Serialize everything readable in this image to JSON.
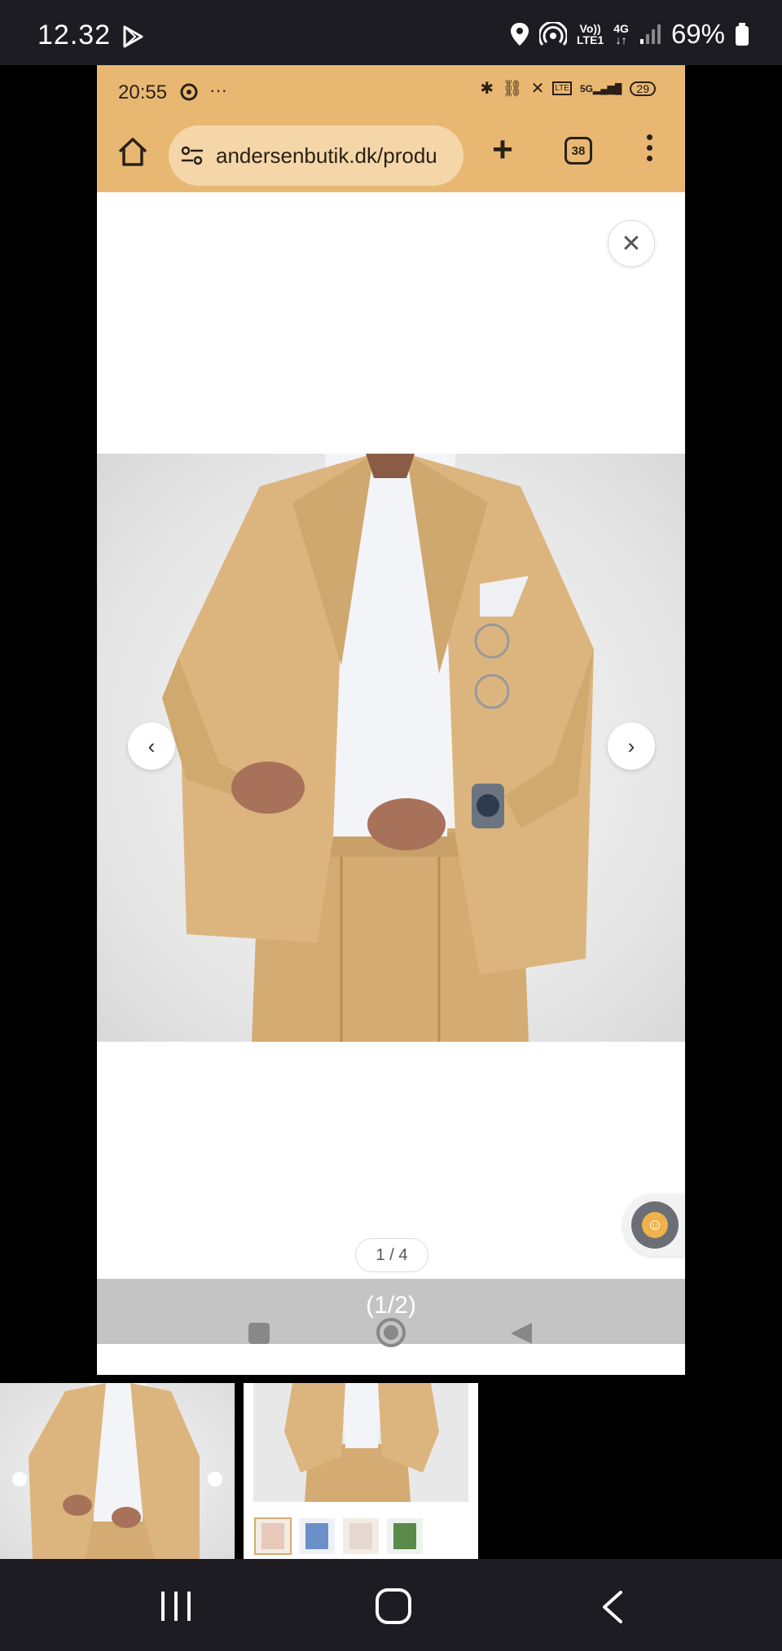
{
  "outer_status": {
    "time": "12.32",
    "network_top": "Vo))",
    "network_bottom": "LTE1",
    "net_type": "4G",
    "battery": "69%"
  },
  "inner_status": {
    "time": "20:55",
    "battery": "29"
  },
  "browser": {
    "url": "andersenbutik.dk/produ",
    "tab_count": "38"
  },
  "lightbox": {
    "counter": "1 / 4"
  },
  "inner_navbar": {
    "page_indicator": "(1/2)"
  },
  "colors": {
    "browser_bar": "#e8b873",
    "suit": "#d9b27c"
  }
}
